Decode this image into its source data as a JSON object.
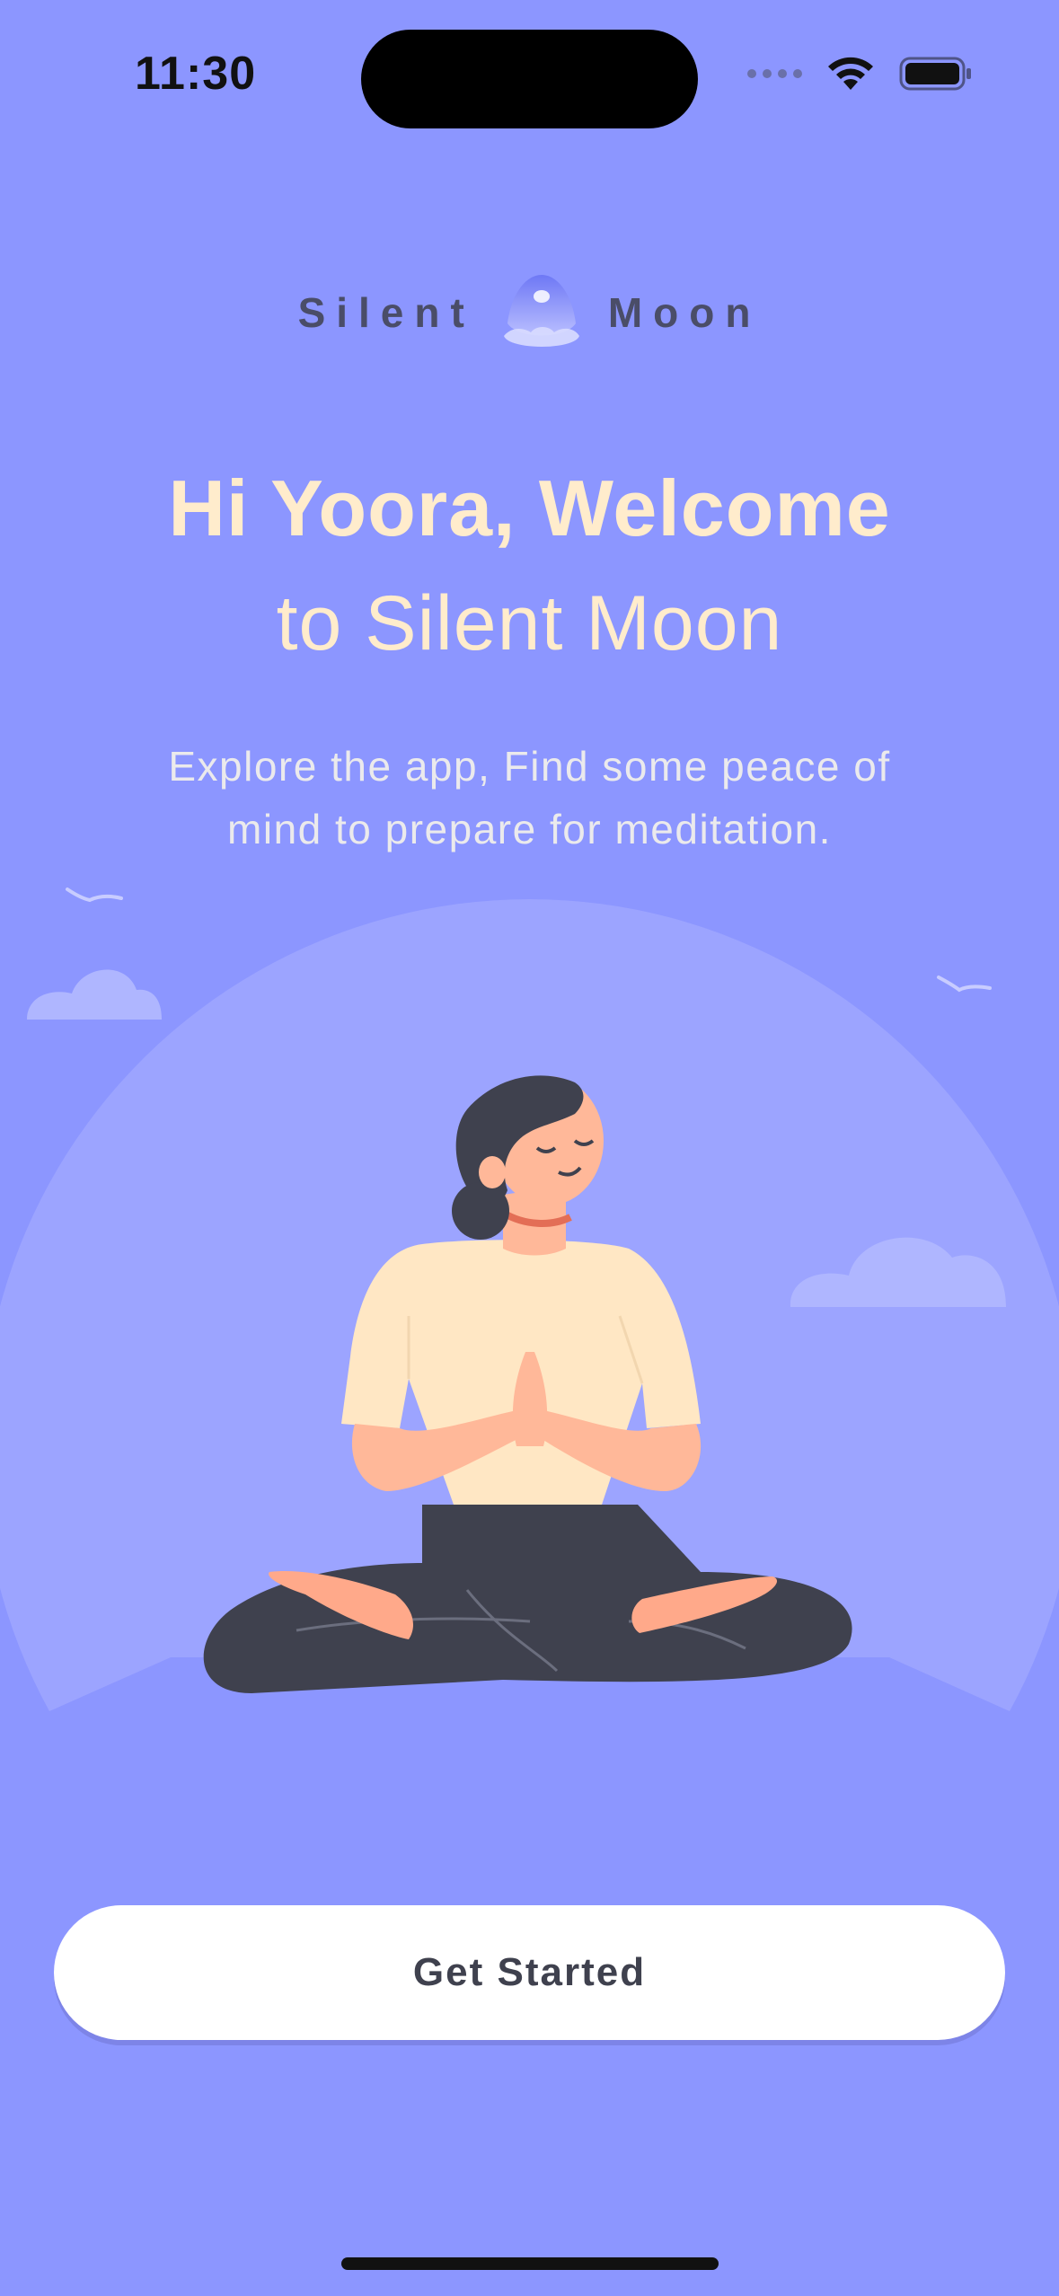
{
  "status_bar": {
    "time": "11:30",
    "icons": [
      "signal-dots-icon",
      "wifi-icon",
      "battery-icon"
    ]
  },
  "logo": {
    "left_word": "Silent",
    "right_word": "Moon",
    "icon": "moon-logo-icon"
  },
  "welcome": {
    "headline_line1": "Hi Yoora, Welcome",
    "headline_line2": "to Silent Moon",
    "subtitle": "Explore the app, Find some peace of mind to prepare for meditation."
  },
  "illustration": {
    "subject": "meditating-woman-illustration"
  },
  "cta": {
    "label": "Get Started"
  },
  "colors": {
    "background": "#8C96FF",
    "headline": "#FFECCC",
    "button_bg": "#FFFFFF",
    "button_text": "#3F414E"
  }
}
